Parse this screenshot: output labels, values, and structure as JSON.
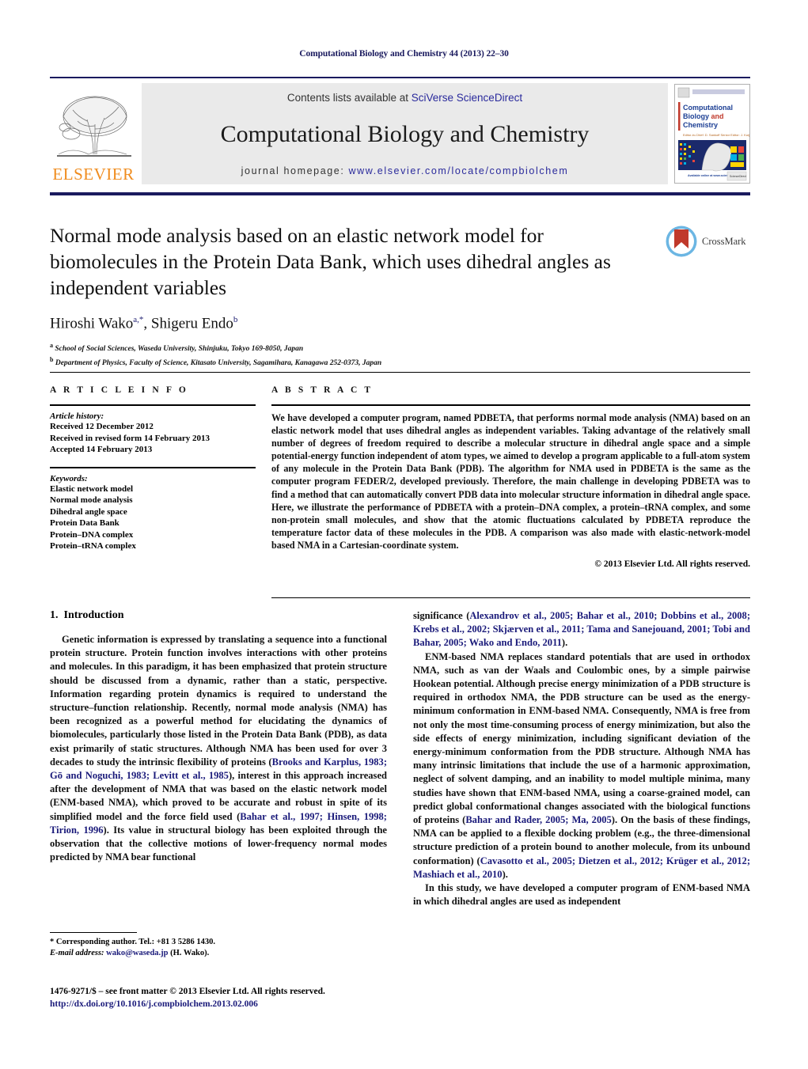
{
  "running_head": "Computational Biology and Chemistry 44 (2013) 22–30",
  "masthead": {
    "contents_prefix": "Contents lists available at ",
    "contents_link": "SciVerse ScienceDirect",
    "journal_name": "Computational Biology and Chemistry",
    "homepage_prefix": "journal homepage: ",
    "homepage_url": "www.elsevier.com/locate/compbiolchem",
    "publisher": "ELSEVIER",
    "cover_title_line1": "Computational",
    "cover_title_line2": "Biology and",
    "cover_title_line3": "Chemistry"
  },
  "crossmark": {
    "label": "CrossMark"
  },
  "article": {
    "title": "Normal mode analysis based on an elastic network model for biomolecules in the Protein Data Bank, which uses dihedral angles as independent variables",
    "authors_html": "Hiroshi Wako<sup>a,*</sup>, Shigeru Endo<sup>b</sup>",
    "affiliation_a_sup": "a",
    "affiliation_a": "School of Social Sciences, Waseda University, Shinjuku, Tokyo 169-8050, Japan",
    "affiliation_b_sup": "b",
    "affiliation_b": "Department of Physics, Faculty of Science, Kitasato University, Sagamihara, Kanagawa 252-0373, Japan"
  },
  "info": {
    "heading": "A R T I C L E   I N F O",
    "history_label": "Article history:",
    "history": [
      "Received 12 December 2012",
      "Received in revised form 14 February 2013",
      "Accepted 14 February 2013"
    ],
    "keywords_label": "Keywords:",
    "keywords": [
      "Elastic network model",
      "Normal mode analysis",
      "Dihedral angle space",
      "Protein Data Bank",
      "Protein–DNA complex",
      "Protein–tRNA complex"
    ]
  },
  "abstract": {
    "heading": "A B S T R A C T",
    "text": "We have developed a computer program, named PDBETA, that performs normal mode analysis (NMA) based on an elastic network model that uses dihedral angles as independent variables. Taking advantage of the relatively small number of degrees of freedom required to describe a molecular structure in dihedral angle space and a simple potential-energy function independent of atom types, we aimed to develop a program applicable to a full-atom system of any molecule in the Protein Data Bank (PDB). The algorithm for NMA used in PDBETA is the same as the computer program FEDER/2, developed previously. Therefore, the main challenge in developing PDBETA was to find a method that can automatically convert PDB data into molecular structure information in dihedral angle space. Here, we illustrate the performance of PDBETA with a protein–DNA complex, a protein–tRNA complex, and some non-protein small molecules, and show that the atomic fluctuations calculated by PDBETA reproduce the temperature factor data of these molecules in the PDB. A comparison was also made with elastic-network-model based NMA in a Cartesian-coordinate system.",
    "copyright": "© 2013 Elsevier Ltd. All rights reserved."
  },
  "section": {
    "number": "1.",
    "title": "Introduction"
  },
  "body": {
    "left_para_1_parts": [
      {
        "t": "Genetic information is expressed by translating a sequence into a functional protein structure. Protein function involves interactions with other proteins and molecules. In this paradigm, it has been emphasized that protein structure should be discussed from a dynamic, rather than a static, perspective. Information regarding protein dynamics is required to understand the structure–function relationship. Recently, normal mode analysis (NMA) has been recognized as a powerful method for elucidating the dynamics of biomolecules, particularly those listed in the Protein Data Bank (PDB), as data exist primarily of static structures. Although NMA has been used for over 3 decades to study the intrinsic flexibility of proteins (",
        "c": false
      },
      {
        "t": "Brooks and Karplus, 1983; Gō and Noguchi, 1983; Levitt et al., 1985",
        "c": true
      },
      {
        "t": "), interest in this approach increased after the development of NMA that was based on the elastic network model (ENM-based NMA), which proved to be accurate and robust in spite of its simplified model and the force field used (",
        "c": false
      },
      {
        "t": "Bahar et al., 1997; Hinsen, 1998; Tirion, 1996",
        "c": true
      },
      {
        "t": "). Its value in structural biology has been exploited through the observation that the collective motions of lower-frequency normal modes predicted by NMA bear functional ",
        "c": false
      },
      {
        "t": "",
        "c": true
      }
    ],
    "right_para_1_parts": [
      {
        "t": "significance (",
        "c": false
      },
      {
        "t": "Alexandrov et al., 2005; Bahar et al., 2010; Dobbins et al., 2008; Krebs et al., 2002; Skjærven et al., 2011; Tama and Sanejouand, 2001; Tobi and Bahar, 2005; Wako and Endo, 2011",
        "c": true
      },
      {
        "t": ").",
        "c": false
      }
    ],
    "right_para_2_parts": [
      {
        "t": "ENM-based NMA replaces standard potentials that are used in orthodox NMA, such as van der Waals and Coulombic ones, by a simple pairwise Hookean potential. Although precise energy minimization of a PDB structure is required in orthodox NMA, the PDB structure can be used as the energy-minimum conformation in ENM-based NMA. Consequently, NMA is free from not only the most time-consuming process of energy minimization, but also the side effects of energy minimization, including significant deviation of the energy-minimum conformation from the PDB structure. Although NMA has many intrinsic limitations that include the use of a harmonic approximation, neglect of solvent damping, and an inability to model multiple minima, many studies have shown that ENM-based NMA, using a coarse-grained model, can predict global conformational changes associated with the biological functions of proteins (",
        "c": false
      },
      {
        "t": "Bahar and Rader, 2005; Ma, 2005",
        "c": true
      },
      {
        "t": "). On the basis of these findings, NMA can be applied to a flexible docking problem (e.g., the three-dimensional structure prediction of a protein bound to another molecule, from its unbound conformation) (",
        "c": false
      },
      {
        "t": "Cavasotto et al., 2005; Dietzen et al., 2012; Krüger et al., 2012; Mashiach et al., 2010",
        "c": true
      },
      {
        "t": ").",
        "c": false
      }
    ],
    "right_para_3_parts": [
      {
        "t": "In this study, we have developed a computer program of ENM-based NMA in which dihedral angles are used as independent",
        "c": false
      }
    ]
  },
  "footnote": {
    "corresponding": "* Corresponding author. Tel.: +81 3 5286 1430.",
    "email_label": "E-mail address:",
    "email": "wako@waseda.jp",
    "email_suffix": "(H. Wako)."
  },
  "imprint": {
    "line1": "1476-9271/$ – see front matter © 2013 Elsevier Ltd. All rights reserved.",
    "doi": "http://dx.doi.org/10.1016/j.compbiolchem.2013.02.006"
  }
}
